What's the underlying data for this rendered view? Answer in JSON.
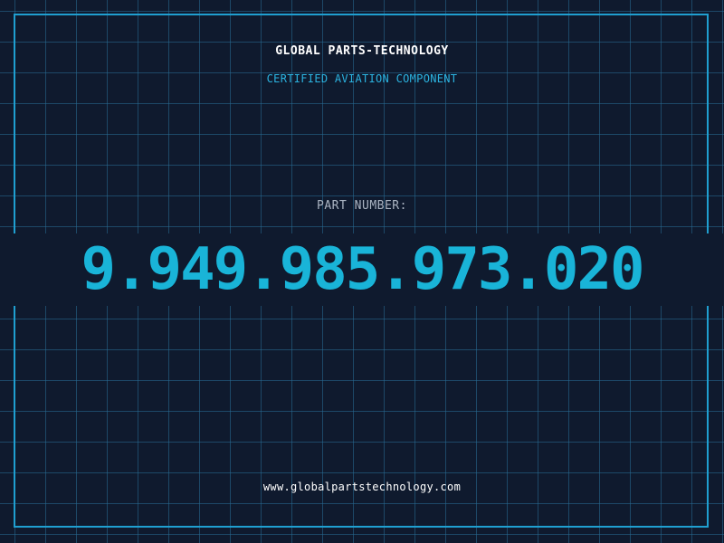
{
  "header": {
    "company": "GLOBAL PARTS-TECHNOLOGY",
    "subtitle": "CERTIFIED AVIATION COMPONENT"
  },
  "part": {
    "label": "PART NUMBER:",
    "number": "9.949.985.973.020"
  },
  "footer": {
    "url": "www.globalpartstechnology.com"
  },
  "colors": {
    "background": "#0f1a2e",
    "grid": "#286e96",
    "frame": "#1f9fd0",
    "accent": "#19b4d8",
    "label": "#aab4c2",
    "text": "#ffffff"
  }
}
